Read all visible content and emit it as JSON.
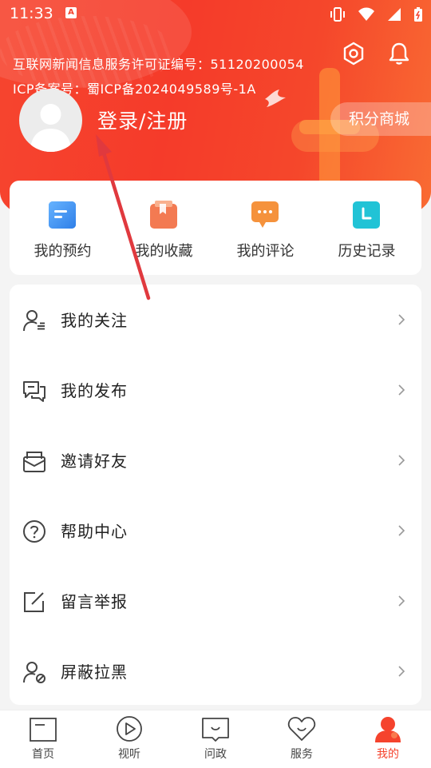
{
  "status_bar": {
    "time": "11:33",
    "notif_badge": "A"
  },
  "header": {
    "license_line1": "互联网新闻信息服务许可证编号：51120200054",
    "license_line2": "ICP备案号：蜀ICP备2024049589号-1A",
    "login_label": "登录/注册",
    "points_mall_label": "积分商城",
    "settings_icon": "settings-hexagon-icon",
    "bell_icon": "bell-icon"
  },
  "quick_actions": [
    {
      "label": "我的预约",
      "icon": "reservation-icon",
      "color": "#3d8ff0"
    },
    {
      "label": "我的收藏",
      "icon": "favorites-icon",
      "color": "#f06a4a"
    },
    {
      "label": "我的评论",
      "icon": "comment-icon",
      "color": "#f5923c"
    },
    {
      "label": "历史记录",
      "icon": "history-icon",
      "color": "#21c3d6"
    }
  ],
  "menu": [
    {
      "label": "我的关注",
      "icon": "follow-icon"
    },
    {
      "label": "我的发布",
      "icon": "publish-icon"
    },
    {
      "label": "邀请好友",
      "icon": "invite-icon"
    },
    {
      "label": "帮助中心",
      "icon": "help-icon"
    },
    {
      "label": "留言举报",
      "icon": "report-icon"
    },
    {
      "label": "屏蔽拉黑",
      "icon": "block-icon"
    }
  ],
  "tabbar": [
    {
      "label": "首页",
      "icon": "home-icon"
    },
    {
      "label": "视听",
      "icon": "play-icon"
    },
    {
      "label": "问政",
      "icon": "inquiry-icon"
    },
    {
      "label": "服务",
      "icon": "heart-icon"
    },
    {
      "label": "我的",
      "icon": "profile-icon",
      "active": true
    }
  ],
  "accent_color": "#f5432d"
}
